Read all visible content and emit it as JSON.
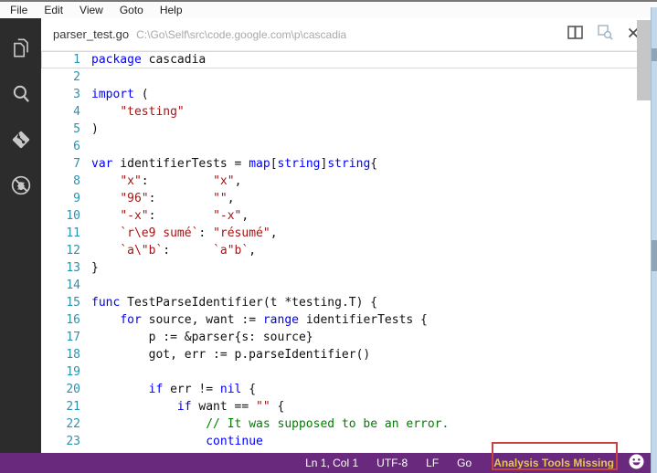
{
  "menu": {
    "items": [
      "File",
      "Edit",
      "View",
      "Goto",
      "Help"
    ]
  },
  "activity_bar": {
    "icons": [
      {
        "name": "explorer-icon"
      },
      {
        "name": "search-icon"
      },
      {
        "name": "git-icon"
      },
      {
        "name": "no-debug-icon"
      }
    ]
  },
  "tab": {
    "title": "parser_test.go",
    "path": "C:\\Go\\Self\\src\\code.google.com\\p\\cascadia",
    "actions": [
      {
        "name": "split-editor-icon"
      },
      {
        "name": "open-preview-icon"
      },
      {
        "name": "close-icon"
      }
    ]
  },
  "editor": {
    "language": "go",
    "current_line": 1,
    "lines": [
      {
        "n": 1,
        "segs": [
          [
            "kw",
            "package"
          ],
          [
            "pl",
            " cascadia"
          ]
        ]
      },
      {
        "n": 2,
        "segs": []
      },
      {
        "n": 3,
        "segs": [
          [
            "kw",
            "import"
          ],
          [
            "pl",
            " ("
          ]
        ]
      },
      {
        "n": 4,
        "segs": [
          [
            "pl",
            "    "
          ],
          [
            "str",
            "\"testing\""
          ]
        ]
      },
      {
        "n": 5,
        "segs": [
          [
            "pl",
            ")"
          ]
        ]
      },
      {
        "n": 6,
        "segs": []
      },
      {
        "n": 7,
        "segs": [
          [
            "kw",
            "var"
          ],
          [
            "pl",
            " identifierTests = "
          ],
          [
            "kw",
            "map"
          ],
          [
            "pl",
            "["
          ],
          [
            "kw",
            "string"
          ],
          [
            "pl",
            "]"
          ],
          [
            "kw",
            "string"
          ],
          [
            "pl",
            "{"
          ]
        ]
      },
      {
        "n": 8,
        "segs": [
          [
            "pl",
            "    "
          ],
          [
            "str",
            "\"x\""
          ],
          [
            "pl",
            ":         "
          ],
          [
            "str",
            "\"x\""
          ],
          [
            "pl",
            ","
          ]
        ]
      },
      {
        "n": 9,
        "segs": [
          [
            "pl",
            "    "
          ],
          [
            "str",
            "\"96\""
          ],
          [
            "pl",
            ":        "
          ],
          [
            "str",
            "\"\""
          ],
          [
            "pl",
            ","
          ]
        ]
      },
      {
        "n": 10,
        "segs": [
          [
            "pl",
            "    "
          ],
          [
            "str",
            "\"-x\""
          ],
          [
            "pl",
            ":        "
          ],
          [
            "str",
            "\"-x\""
          ],
          [
            "pl",
            ","
          ]
        ]
      },
      {
        "n": 11,
        "segs": [
          [
            "pl",
            "    "
          ],
          [
            "str",
            "`r\\e9 sumé`"
          ],
          [
            "pl",
            ": "
          ],
          [
            "str",
            "\"résumé\""
          ],
          [
            "pl",
            ","
          ]
        ]
      },
      {
        "n": 12,
        "segs": [
          [
            "pl",
            "    "
          ],
          [
            "str",
            "`a\\\"b`"
          ],
          [
            "pl",
            ":      "
          ],
          [
            "str",
            "`a\"b`"
          ],
          [
            "pl",
            ","
          ]
        ]
      },
      {
        "n": 13,
        "segs": [
          [
            "pl",
            "}"
          ]
        ]
      },
      {
        "n": 14,
        "segs": []
      },
      {
        "n": 15,
        "segs": [
          [
            "kw",
            "func"
          ],
          [
            "pl",
            " TestParseIdentifier(t *testing.T) {"
          ]
        ]
      },
      {
        "n": 16,
        "segs": [
          [
            "pl",
            "    "
          ],
          [
            "kw",
            "for"
          ],
          [
            "pl",
            " source, want := "
          ],
          [
            "kw",
            "range"
          ],
          [
            "pl",
            " identifierTests {"
          ]
        ]
      },
      {
        "n": 17,
        "segs": [
          [
            "pl",
            "        p := &parser{s: source}"
          ]
        ]
      },
      {
        "n": 18,
        "segs": [
          [
            "pl",
            "        got, err := p.parseIdentifier()"
          ]
        ]
      },
      {
        "n": 19,
        "segs": []
      },
      {
        "n": 20,
        "segs": [
          [
            "pl",
            "        "
          ],
          [
            "kw",
            "if"
          ],
          [
            "pl",
            " err != "
          ],
          [
            "kw",
            "nil"
          ],
          [
            "pl",
            " {"
          ]
        ]
      },
      {
        "n": 21,
        "segs": [
          [
            "pl",
            "            "
          ],
          [
            "kw",
            "if"
          ],
          [
            "pl",
            " want == "
          ],
          [
            "str",
            "\"\""
          ],
          [
            "pl",
            " {"
          ]
        ]
      },
      {
        "n": 22,
        "segs": [
          [
            "pl",
            "                "
          ],
          [
            "com",
            "// It was supposed to be an error."
          ]
        ]
      },
      {
        "n": 23,
        "segs": [
          [
            "pl",
            "                "
          ],
          [
            "kw",
            "continue"
          ]
        ]
      }
    ]
  },
  "status_bar": {
    "items": [
      {
        "name": "cursor-position",
        "label": "Ln 1, Col 1"
      },
      {
        "name": "encoding",
        "label": "UTF-8"
      },
      {
        "name": "eol-indicator",
        "label": "LF"
      },
      {
        "name": "language-mode",
        "label": "Go"
      }
    ],
    "warning": {
      "label": "Analysis Tools Missing"
    },
    "smiley": {
      "name": "feedback-smiley-icon"
    }
  },
  "colors": {
    "keyword": "#0000ff",
    "string": "#a31515",
    "comment": "#008000",
    "text": "#111111",
    "line_number": "#2b91af",
    "status_bg": "#692a7e",
    "warning_text": "#e9c64b",
    "annotation_border": "#c94141",
    "activity_bar_bg": "#2c2c2c"
  }
}
